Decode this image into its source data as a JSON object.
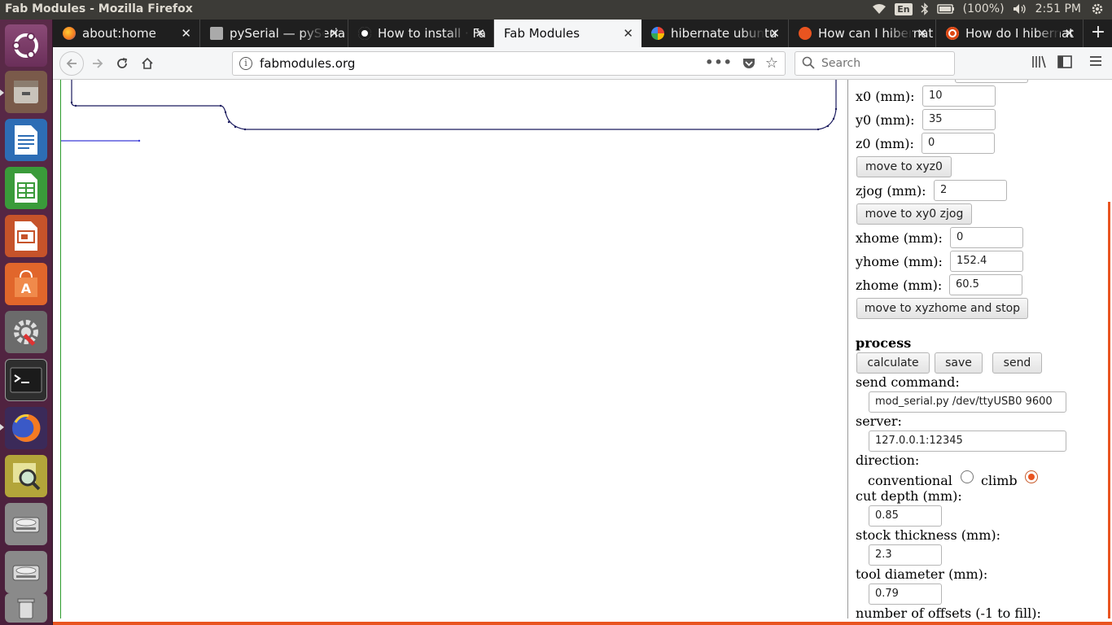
{
  "window_title": "Fab Modules - Mozilla Firefox",
  "tray": {
    "keyboard": "En",
    "battery": "(100%)",
    "time": "2:51 PM"
  },
  "tabs": [
    {
      "label": "about:home",
      "icon": "firefox-icon",
      "active": false
    },
    {
      "label": "pySerial — pySeria",
      "icon": "docs-icon",
      "active": false
    },
    {
      "label": "How to install · Fa",
      "icon": "github-icon",
      "active": false
    },
    {
      "label": "Fab Modules",
      "icon": "none",
      "active": true
    },
    {
      "label": "hibernate ubuntu",
      "icon": "google-icon",
      "active": false
    },
    {
      "label": "How can I hibernat",
      "icon": "askubuntu-icon",
      "active": false
    },
    {
      "label": "How do I hibernat",
      "icon": "ubuntu-icon",
      "active": false
    }
  ],
  "nav": {
    "url": "fabmodules.org",
    "search_placeholder": "Search"
  },
  "panel": {
    "x0_label": "x0 (mm):",
    "x0_value": "10",
    "y0_label": "y0 (mm):",
    "y0_value": "35",
    "z0_label": "z0 (mm):",
    "z0_value": "0",
    "move_xyz0": "move to xyz0",
    "zjog_label": "zjog (mm):",
    "zjog_value": "2",
    "move_xy0_zjog": "move to xy0 zjog",
    "xhome_label": "xhome (mm):",
    "xhome_value": "0",
    "yhome_label": "yhome (mm):",
    "yhome_value": "152.4",
    "zhome_label": "zhome (mm):",
    "zhome_value": "60.5",
    "move_xyzhome": "move to xyzhome and stop",
    "process_heading": "process",
    "calculate": "calculate",
    "save": "save",
    "send": "send",
    "send_command_label": "send command:",
    "send_command_value": "mod_serial.py /dev/ttyUSB0 9600",
    "server_label": "server:",
    "server_value": "127.0.0.1:12345",
    "direction_label": "direction:",
    "conventional": "conventional",
    "climb": "climb",
    "direction_selected": "climb",
    "cut_depth_label": "cut depth (mm):",
    "cut_depth_value": "0.85",
    "stock_thickness_label": "stock thickness (mm):",
    "stock_thickness_value": "2.3",
    "tool_diameter_label": "tool diameter (mm):",
    "tool_diameter_value": "0.79",
    "offsets_label": "number of offsets (-1 to fill):"
  },
  "colors": {
    "ubuntu_orange": "#e95420",
    "toolpath": "#1a1a5e",
    "axis_green": "#2c9b2c",
    "axis_blue": "#3b3bd6"
  }
}
